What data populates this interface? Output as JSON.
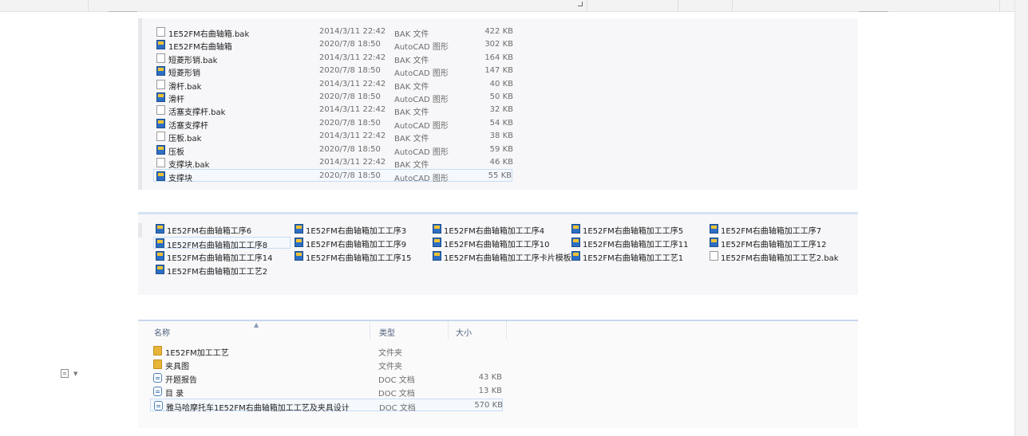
{
  "list1": [
    {
      "name": "1E52FM右曲轴箱.bak",
      "date": "2014/3/11 22:42",
      "type": "BAK 文件",
      "size": "422 KB",
      "icon": "bak-file-icon"
    },
    {
      "name": "1E52FM右曲轴箱",
      "date": "2020/7/8 18:50",
      "type": "AutoCAD 图形",
      "size": "302 KB",
      "icon": "autocad-drawing-icon"
    },
    {
      "name": "短菱形销.bak",
      "date": "2014/3/11 22:42",
      "type": "BAK 文件",
      "size": "164 KB",
      "icon": "bak-file-icon"
    },
    {
      "name": "短菱形销",
      "date": "2020/7/8 18:50",
      "type": "AutoCAD 图形",
      "size": "147 KB",
      "icon": "autocad-drawing-icon"
    },
    {
      "name": "滑杆.bak",
      "date": "2014/3/11 22:42",
      "type": "BAK 文件",
      "size": "40 KB",
      "icon": "bak-file-icon"
    },
    {
      "name": "滑杆",
      "date": "2020/7/8 18:50",
      "type": "AutoCAD 图形",
      "size": "50 KB",
      "icon": "autocad-drawing-icon"
    },
    {
      "name": "活塞支撑杆.bak",
      "date": "2014/3/11 22:42",
      "type": "BAK 文件",
      "size": "32 KB",
      "icon": "bak-file-icon"
    },
    {
      "name": "活塞支撑杆",
      "date": "2020/7/8 18:50",
      "type": "AutoCAD 图形",
      "size": "54 KB",
      "icon": "autocad-drawing-icon"
    },
    {
      "name": "压板.bak",
      "date": "2014/3/11 22:42",
      "type": "BAK 文件",
      "size": "38 KB",
      "icon": "bak-file-icon"
    },
    {
      "name": "压板",
      "date": "2020/7/8 18:50",
      "type": "AutoCAD 图形",
      "size": "59 KB",
      "icon": "autocad-drawing-icon"
    },
    {
      "name": "支撑块.bak",
      "date": "2014/3/11 22:42",
      "type": "BAK 文件",
      "size": "46 KB",
      "icon": "bak-file-icon"
    },
    {
      "name": "支撑块",
      "date": "2020/7/8 18:50",
      "type": "AutoCAD 图形",
      "size": "55 KB",
      "icon": "autocad-drawing-icon"
    }
  ],
  "list2": [
    [
      "1E52FM右曲轴箱工序6",
      "1E52FM右曲轴箱加工工序3",
      "1E52FM右曲轴箱加工工序4",
      "1E52FM右曲轴箱加工工序5",
      "1E52FM右曲轴箱加工工序7"
    ],
    [
      "1E52FM右曲轴箱加工工序8",
      "1E52FM右曲轴箱加工工序9",
      "1E52FM右曲轴箱加工工序10",
      "1E52FM右曲轴箱加工工序11",
      "1E52FM右曲轴箱加工工序12"
    ],
    [
      "1E52FM右曲轴箱加工工序14",
      "1E52FM右曲轴箱加工工序15",
      "1E52FM右曲轴箱加工工序卡片模板...",
      "1E52FM右曲轴箱加工工艺1",
      "1E52FM右曲轴箱加工工艺2.bak"
    ],
    [
      "1E52FM右曲轴箱加工工艺2"
    ]
  ],
  "list3": {
    "headers": {
      "name": "名称",
      "type": "类型",
      "size": "大小"
    },
    "rows": [
      {
        "name": "1E52FM加工工艺",
        "type": "文件夹",
        "size": "",
        "icon": "folder-icon"
      },
      {
        "name": "夹具图",
        "type": "文件夹",
        "size": "",
        "icon": "folder-icon"
      },
      {
        "name": "开题报告",
        "type": "DOC 文档",
        "size": "43 KB",
        "icon": "doc-file-icon"
      },
      {
        "name": "目  录",
        "type": "DOC 文档",
        "size": "13 KB",
        "icon": "doc-file-icon"
      },
      {
        "name": "雅马哈摩托车1E52FM右曲轴箱加工工艺及夹具设计",
        "type": "DOC 文档",
        "size": "570 KB",
        "icon": "doc-file-icon"
      }
    ]
  }
}
